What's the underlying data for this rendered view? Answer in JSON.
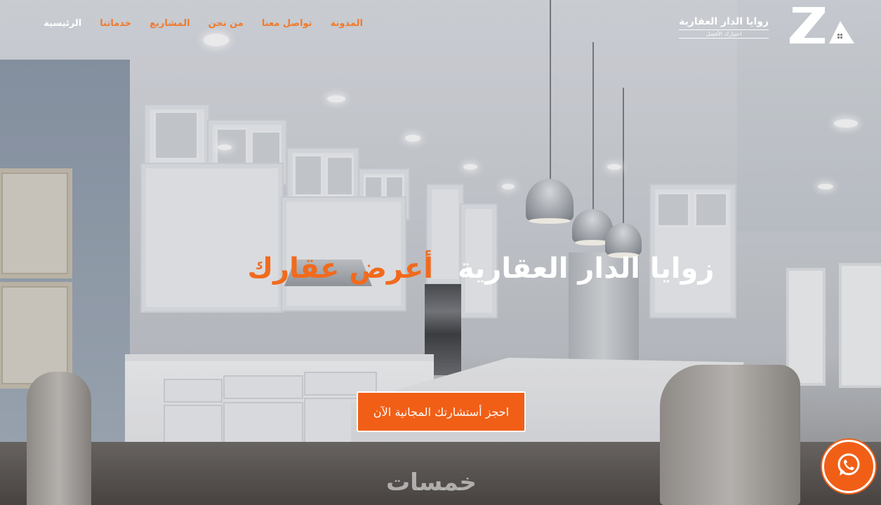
{
  "brand": {
    "name": "زوايا الدار العقارية",
    "tagline": "اختيارك الأفضل",
    "logo_icon": "za-logo-icon"
  },
  "nav": {
    "items": [
      {
        "label": "الرئيسية",
        "active": true
      },
      {
        "label": "خدماتنا",
        "active": false
      },
      {
        "label": "المشاريع",
        "active": false
      },
      {
        "label": "من نحن",
        "active": false
      },
      {
        "label": "تواصل معنا",
        "active": false
      },
      {
        "label": "المدونة",
        "active": false
      }
    ]
  },
  "hero": {
    "title": "زوايا الدار العقارية",
    "title_accent": "أعرض عقارك",
    "cta_label": "احجز أستشارتك المجانية الآن"
  },
  "whatsapp": {
    "icon": "whatsapp-icon"
  },
  "watermark": {
    "text": "خمسات"
  },
  "colors": {
    "accent": "#f15f17",
    "nav_text": "#f07a2c",
    "active_nav": "#ffffff"
  }
}
